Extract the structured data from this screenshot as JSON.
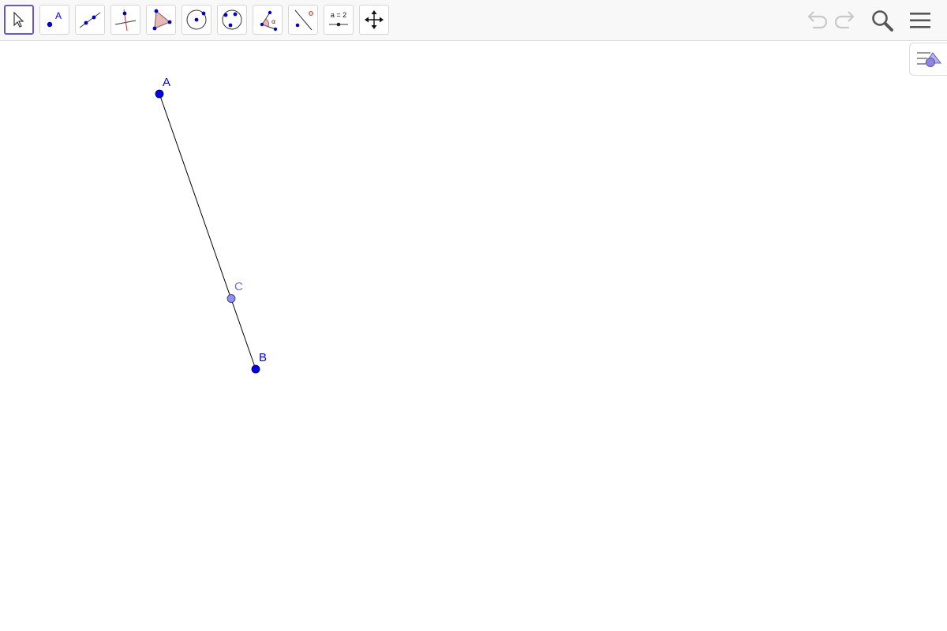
{
  "toolbar": {
    "tools": [
      {
        "name": "move-tool",
        "icon": "arrow-cursor-icon",
        "selected": true
      },
      {
        "name": "point-tool",
        "icon": "point-icon",
        "icon_text": "A"
      },
      {
        "name": "line-tool",
        "icon": "line-through-points-icon"
      },
      {
        "name": "perpendicular-line-tool",
        "icon": "perpendicular-line-icon"
      },
      {
        "name": "polygon-tool",
        "icon": "polygon-icon"
      },
      {
        "name": "circle-center-point-tool",
        "icon": "circle-center-point-icon"
      },
      {
        "name": "circle-three-points-tool",
        "icon": "circle-three-points-icon"
      },
      {
        "name": "angle-tool",
        "icon": "angle-icon",
        "icon_text": "α"
      },
      {
        "name": "reflect-about-line-tool",
        "icon": "reflect-icon"
      },
      {
        "name": "slider-tool",
        "icon": "slider-icon",
        "icon_text": "a = 2"
      },
      {
        "name": "move-graphics-view-tool",
        "icon": "move-arrows-icon"
      }
    ],
    "right_controls": [
      "undo-icon",
      "redo-icon",
      "search-icon",
      "menu-icon"
    ],
    "selected_color": "#6557d2"
  },
  "side_panel": {
    "algebra_toggle_icon": "algebra-view-icon"
  },
  "graphics": {
    "points": [
      {
        "label": "A",
        "color": "#0000ff"
      },
      {
        "label": "B",
        "color": "#0000ff"
      },
      {
        "label": "C",
        "color": "#6c6ce0"
      }
    ],
    "segment": {
      "from": "A",
      "to": "B",
      "color": "#000000"
    }
  }
}
